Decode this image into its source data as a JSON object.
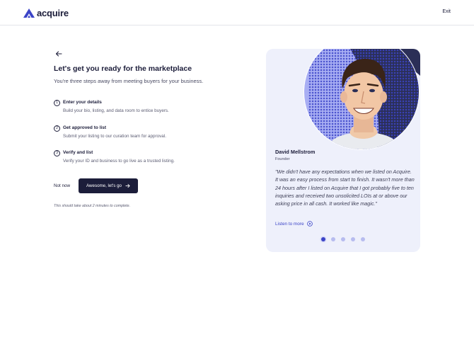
{
  "header": {
    "logo_text": "acquire",
    "exit_label": "Exit"
  },
  "main": {
    "title": "Let's get you ready for the marketplace",
    "subtitle": "You're three steps away from meeting buyers for your business.",
    "steps": [
      {
        "number": "1",
        "title": "Enter your details",
        "description": "Build your bio, listing, and data room to entice buyers."
      },
      {
        "number": "2",
        "title": "Get approved to list",
        "description": "Submit your listing to our curation team for approval."
      },
      {
        "number": "3",
        "title": "Verify and list",
        "description": "Verify your ID and business to go live as a trusted listing."
      }
    ],
    "not_now_label": "Not now",
    "cta_label": "Awesome, let's go",
    "note": "This should take about 2 minutes to complete."
  },
  "testimonial": {
    "name": "David Mellstrom",
    "role": "Founder",
    "quote": "\"We didn't have any expectations when we listed on Acquire. It was an easy process from start to finish. It wasn't more than 24 hours after I listed on Acquire that I got probably five to ten inquiries and received two unsolicited LOIs at or above our asking price in all cash. It worked like magic.\"",
    "listen_label": "Listen to more",
    "slides": 5,
    "active_slide": 1
  },
  "colors": {
    "brand": "#3b44c7",
    "dark": "#1c1d3a",
    "card_bg": "#eef0fb"
  }
}
